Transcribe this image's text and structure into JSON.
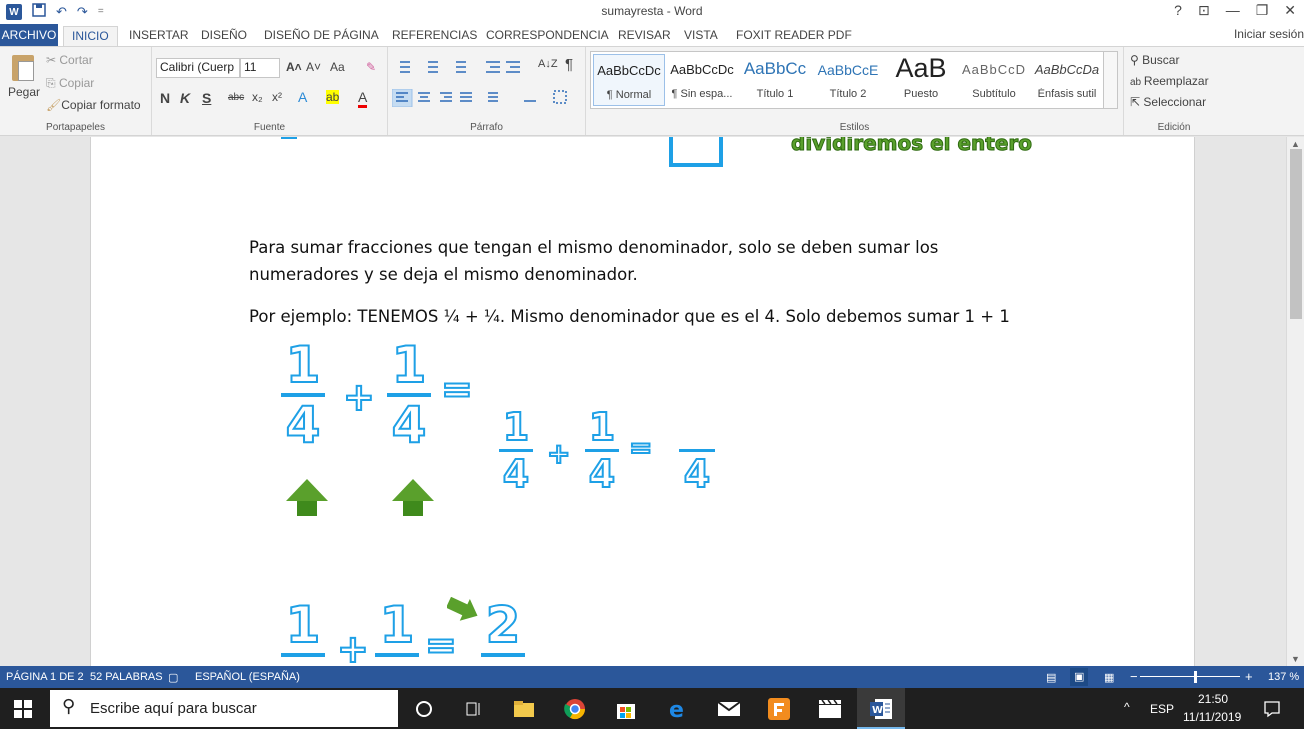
{
  "window": {
    "title": "sumayresta - Word",
    "word_logo": "W",
    "help": "?",
    "minimize": "—",
    "restore": "❐",
    "close": "✕",
    "ribbon_display": "⊡"
  },
  "qat": {
    "save_icon": "💾",
    "undo_icon": "↶",
    "redo_icon": "↷",
    "customize": "="
  },
  "tabs": {
    "file": "ARCHIVO",
    "items": [
      "INICIO",
      "INSERTAR",
      "DISEÑO",
      "DISEÑO DE PÁGINA",
      "REFERENCIAS",
      "CORRESPONDENCIA",
      "REVISAR",
      "VISTA",
      "FOXIT READER PDF"
    ],
    "active": "INICIO",
    "signin": "Iniciar sesión"
  },
  "ribbon": {
    "clipboard": {
      "paste": "Pegar",
      "cut": "Cortar",
      "copy": "Copiar",
      "format_painter": "Copiar formato",
      "label": "Portapapeles"
    },
    "font": {
      "font_name": "Calibri (Cuerp",
      "font_size": "11",
      "grow": "A˄",
      "shrink": "A˅",
      "case": "Aa",
      "clear": "✎",
      "bold": "N",
      "italic": "K",
      "underline": "S",
      "strike": "abc",
      "sub": "x₂",
      "sup": "x²",
      "effects": "A",
      "highlight": "ab",
      "color": "A",
      "label": "Fuente"
    },
    "paragraph": {
      "label": "Párrafo",
      "pilcrow": "¶",
      "sort": "A↓Z"
    },
    "styles": {
      "label": "Estilos",
      "items": [
        {
          "sample": "AaBbCcDc",
          "name": "¶ Normal"
        },
        {
          "sample": "AaBbCcDc",
          "name": "¶ Sin espa..."
        },
        {
          "sample": "AaBbCc",
          "name": "Título 1"
        },
        {
          "sample": "AaBbCcE",
          "name": "Título 2"
        },
        {
          "sample": "AaB",
          "name": "Puesto"
        },
        {
          "sample": "AaBbCcD",
          "name": "Subtítulo"
        },
        {
          "sample": "AaBbCcDa",
          "name": "Énfasis sutil"
        }
      ]
    },
    "editing": {
      "find": "Buscar",
      "replace": "Reemplazar",
      "select": "Seleccionar",
      "label": "Edición"
    }
  },
  "document": {
    "green_caption": "dividiremos el entero",
    "paragraph1_line1": "Para sumar fracciones que tengan el mismo denominador, solo se deben sumar los",
    "paragraph1_line2": "numeradores y se deja el mismo denominador.",
    "paragraph2": "Por ejemplo: TENEMOS ¼ + ¼. Mismo denominador que es el 4. Solo debemos sumar  1 + 1",
    "fig1": {
      "n1": "1",
      "d1": "4",
      "plus": "+",
      "n2": "1",
      "d2": "4",
      "eq": "="
    },
    "fig2": {
      "n1": "1",
      "d1": "4",
      "plus": "+",
      "n2": "1",
      "d2": "4",
      "eq": "=",
      "d3": "4"
    },
    "fig3": {
      "n1": "1",
      "n2": "1",
      "n3": "2",
      "plus": "+",
      "eq": "="
    }
  },
  "statusbar": {
    "page": "PÁGINA 1 DE 2",
    "words": "52 PALABRAS",
    "language": "ESPAÑOL (ESPAÑA)",
    "zoom": "137 %",
    "zoom_minus": "−",
    "zoom_plus": "+"
  },
  "taskbar": {
    "search_placeholder": "Escribe aquí para buscar",
    "tray_lang": "ESP",
    "time": "21:50",
    "date": "11/11/2019",
    "chevron": "^"
  },
  "colors": {
    "word_blue": "#2b579a",
    "fraction_blue": "#1ea0e6",
    "arrow_green": "#5aa02c"
  }
}
